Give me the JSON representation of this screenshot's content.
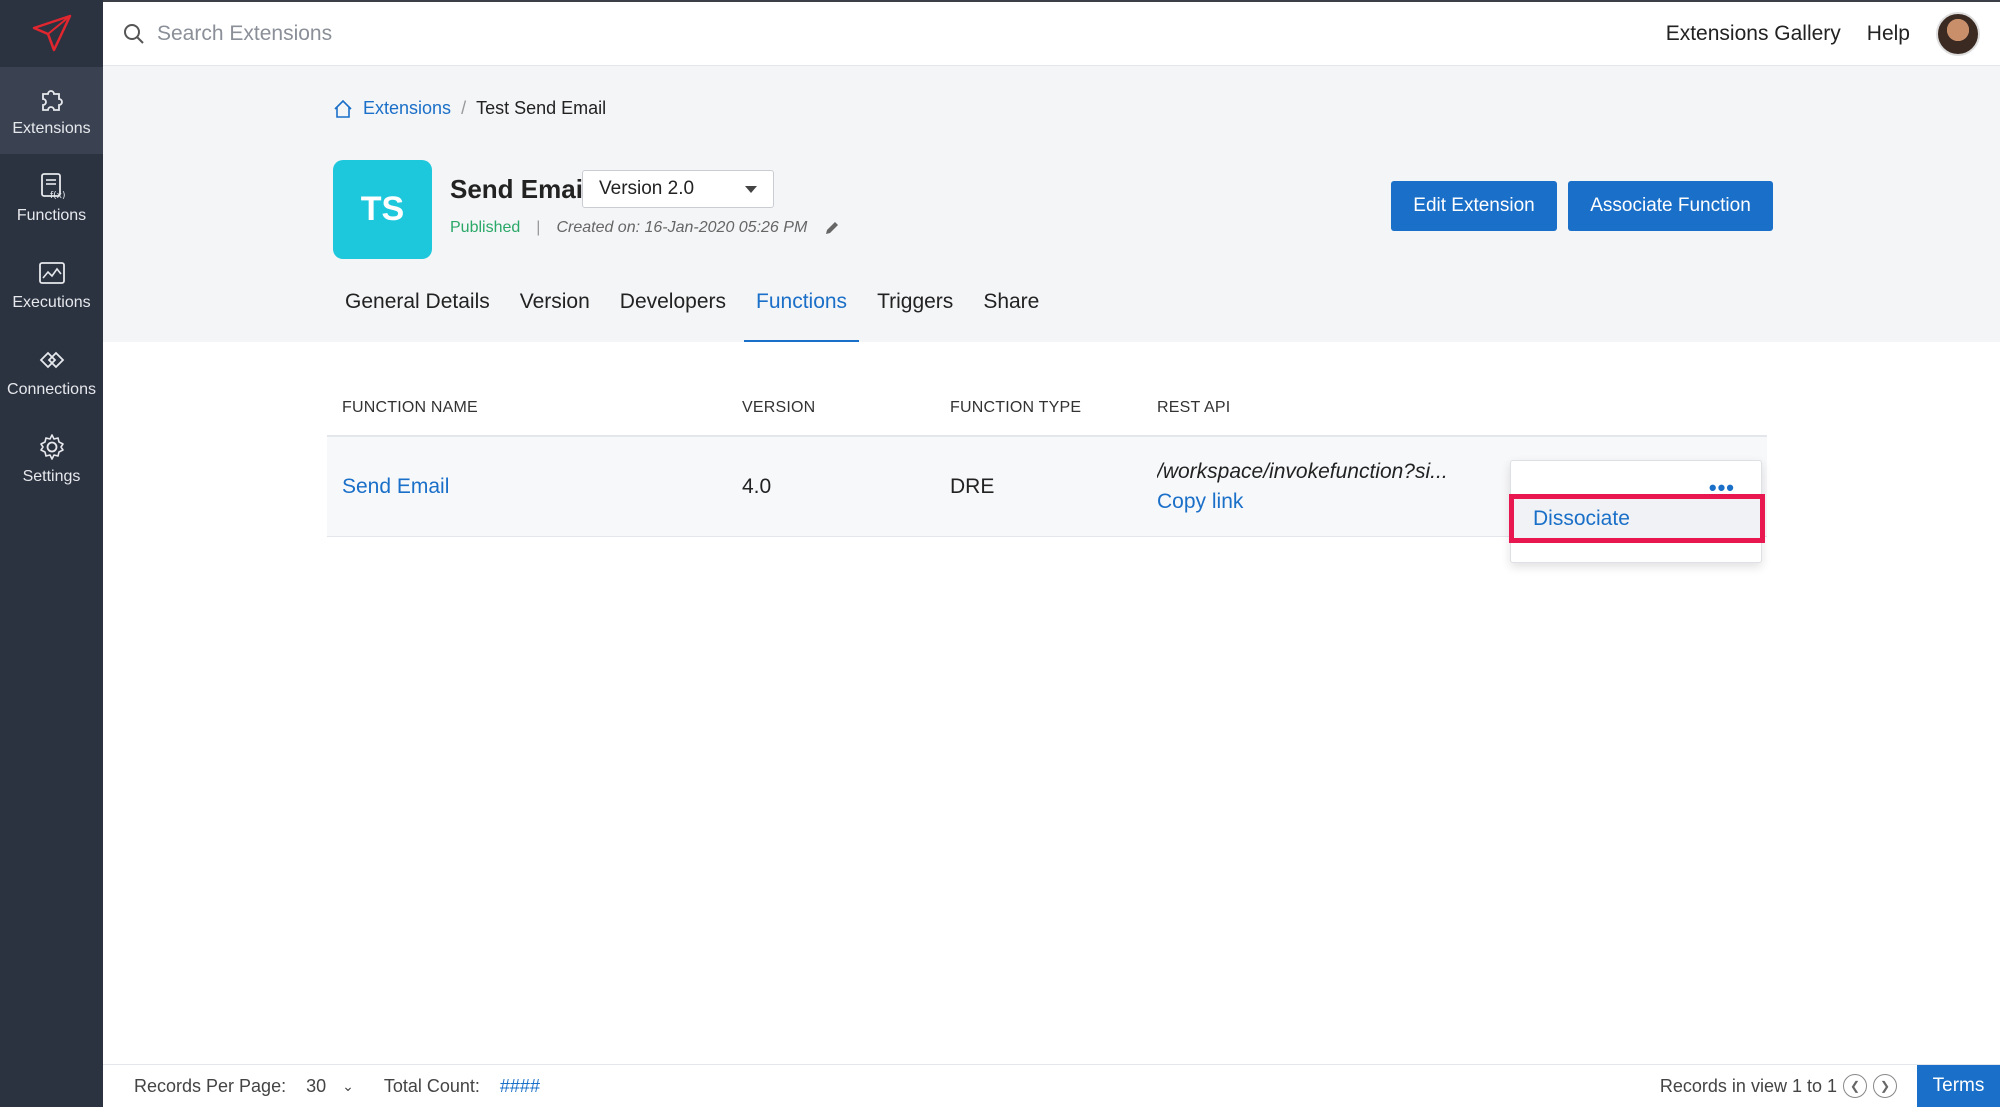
{
  "sidebar": {
    "logo_icon": "paper-plane-logo-icon",
    "items": [
      {
        "label": "Extensions",
        "icon": "puzzle-icon",
        "active": true
      },
      {
        "label": "Functions",
        "icon": "function-icon",
        "active": false
      },
      {
        "label": "Executions",
        "icon": "chart-icon",
        "active": false
      },
      {
        "label": "Connections",
        "icon": "connections-icon",
        "active": false
      },
      {
        "label": "Settings",
        "icon": "gear-icon",
        "active": false
      }
    ]
  },
  "topbar": {
    "search_placeholder": "Search Extensions",
    "gallery_label": "Extensions Gallery",
    "help_label": "Help"
  },
  "breadcrumb": {
    "root": "Extensions",
    "separator": "/",
    "current": "Test Send Email"
  },
  "extension": {
    "logo_text": "TS",
    "logo_color": "#1ec8dc",
    "title": "Send Email",
    "version": "Version 2.0",
    "status": "Published",
    "separator": "|",
    "created": "Created on: 16-Jan-2020 05:26 PM"
  },
  "actions": {
    "edit_label": "Edit Extension",
    "associate_label": "Associate Function"
  },
  "tabs": [
    {
      "label": "General Details",
      "active": false
    },
    {
      "label": "Version",
      "active": false
    },
    {
      "label": "Developers",
      "active": false
    },
    {
      "label": "Functions",
      "active": true
    },
    {
      "label": "Triggers",
      "active": false
    },
    {
      "label": "Share",
      "active": false
    }
  ],
  "table": {
    "columns": [
      "FUNCTION NAME",
      "VERSION",
      "FUNCTION TYPE",
      "REST API"
    ],
    "rows": [
      {
        "name": "Send Email",
        "version": "4.0",
        "type": "DRE",
        "rest_api": "/workspace/invokefunction?si...",
        "copy_label": "Copy link"
      }
    ]
  },
  "menu": {
    "dots": "•••",
    "dissociate_label": "Dissociate"
  },
  "footer": {
    "records_per_page_label": "Records Per Page:",
    "records_per_page_value": "30",
    "total_count_label": "Total Count:",
    "total_count_value": "####",
    "records_in_view": "Records in view 1 to 1",
    "terms_label": "Terms"
  },
  "colors": {
    "accent": "#1a6fc8",
    "sidebar": "#2b3240",
    "published": "#2aa868",
    "highlight": "#e8174f"
  }
}
